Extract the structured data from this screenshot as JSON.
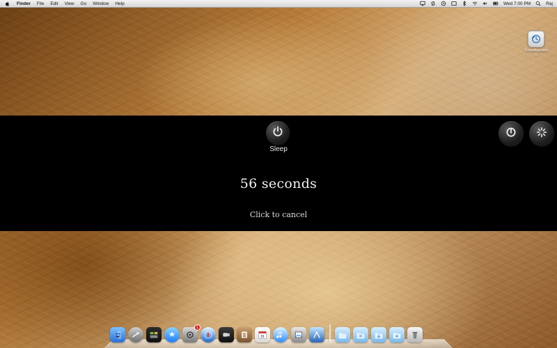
{
  "menubar": {
    "app_name": "Finder",
    "items": [
      "File",
      "Edit",
      "View",
      "Go",
      "Window",
      "Help"
    ],
    "clock": "Wed 7:00 PM",
    "user": "Raj"
  },
  "desktop": {
    "time_machine_label_line1": "TimeMachine",
    "time_machine_label_line2": "0"
  },
  "overlay": {
    "sleep_label": "Sleep",
    "countdown": "56 seconds",
    "cancel_text": "Click to cancel"
  },
  "dock": {
    "badge_system_prefs": "1",
    "calendar_day": "31"
  },
  "icons": {
    "apple": "apple-logo-icon",
    "sleep": "power-icon",
    "shutdown": "power-icon",
    "restart": "spinner-icon",
    "time_machine": "time-machine-icon"
  }
}
